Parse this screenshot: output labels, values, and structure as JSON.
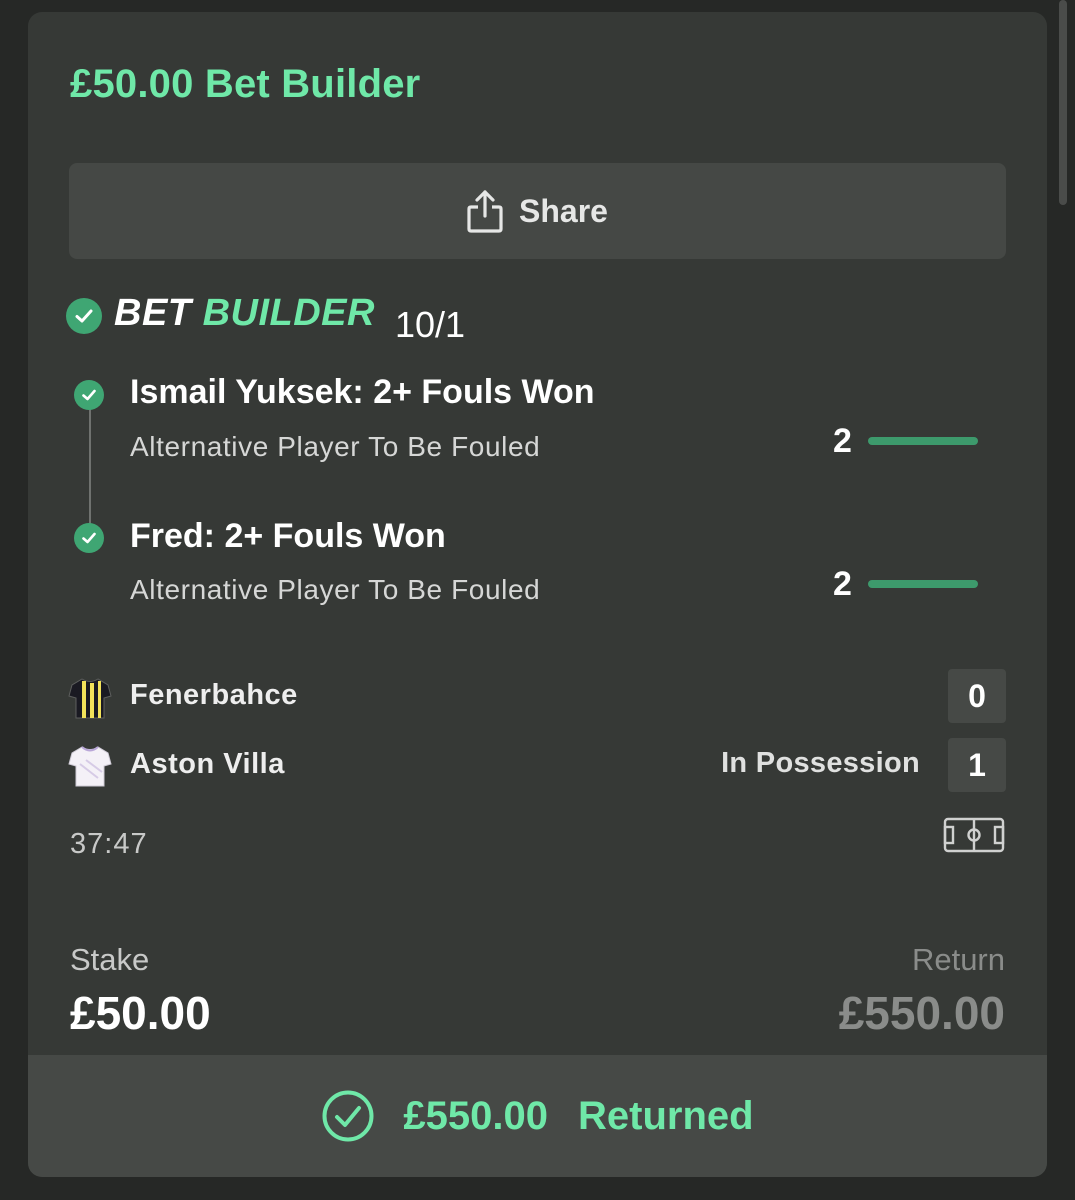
{
  "bet": {
    "title": "£50.00 Bet Builder",
    "share_label": "Share",
    "type_word1": "BET",
    "type_word2": "BUILDER",
    "odds": "10/1"
  },
  "selections": [
    {
      "title": "Ismail Yuksek: 2+ Fouls Won",
      "market": "Alternative Player To Be Fouled",
      "count": "2",
      "progress": 1.0
    },
    {
      "title": "Fred: 2+ Fouls Won",
      "market": "Alternative Player To Be Fouled",
      "count": "2",
      "progress": 1.0
    }
  ],
  "match": {
    "home": {
      "name": "Fenerbahce",
      "score": "0"
    },
    "away": {
      "name": "Aston Villa",
      "score": "1"
    },
    "possession": "In Possession",
    "clock": "37:47"
  },
  "totals": {
    "stake_label": "Stake",
    "stake": "£50.00",
    "return_label": "Return",
    "return": "£550.00"
  },
  "footer": {
    "amount": "£550.00",
    "status": "Returned"
  },
  "colors": {
    "accent": "#6fe8a8",
    "win_green": "#3fa673",
    "card_bg": "#363936"
  }
}
